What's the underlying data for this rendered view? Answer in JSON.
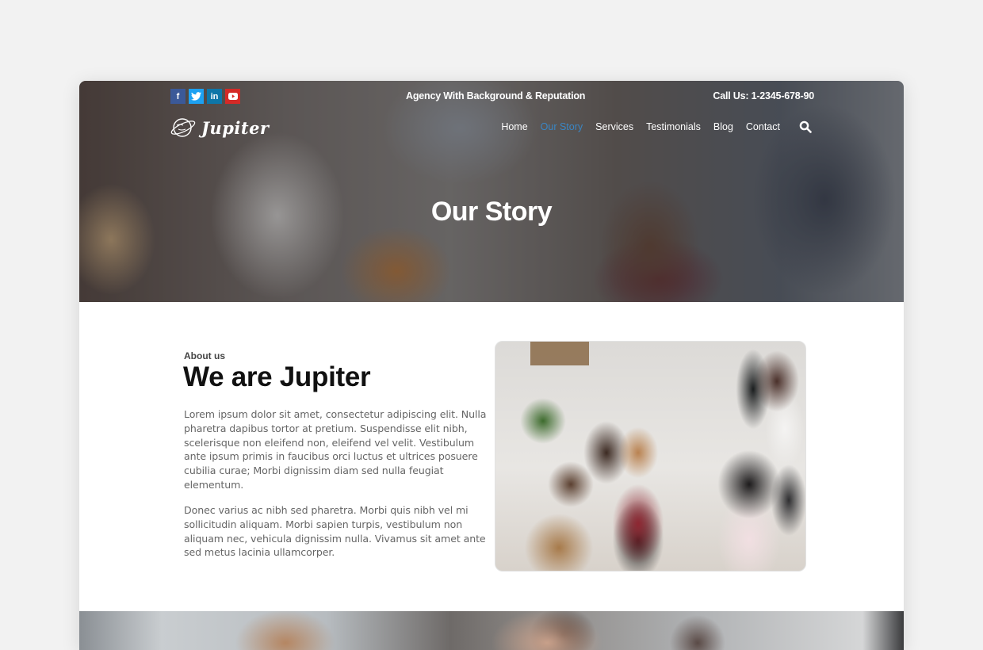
{
  "header": {
    "social": [
      {
        "name": "facebook",
        "glyph": "f",
        "color": "#3b5998"
      },
      {
        "name": "twitter",
        "glyph": "t",
        "color": "#1da1f2"
      },
      {
        "name": "linkedin",
        "glyph": "in",
        "color": "#0e76a8"
      },
      {
        "name": "youtube",
        "glyph": "▶",
        "color": "#d52a27"
      }
    ],
    "tagline": "Agency With Background & Reputation",
    "phone": "Call Us: 1-2345-678-90",
    "logo_text": "Jupiter",
    "nav": [
      {
        "label": "Home",
        "active": false
      },
      {
        "label": "Our Story",
        "active": true
      },
      {
        "label": "Services",
        "active": false
      },
      {
        "label": "Testimonials",
        "active": false
      },
      {
        "label": "Blog",
        "active": false
      },
      {
        "label": "Contact",
        "active": false
      }
    ],
    "search_icon": "search-icon",
    "active_color": "#3a86c4"
  },
  "hero": {
    "title": "Our Story"
  },
  "about": {
    "label": "About us",
    "title": "We are Jupiter",
    "paragraphs": [
      "Lorem ipsum dolor sit amet, consectetur adipiscing elit. Nulla pharetra dapibus tortor at pretium. Suspendisse elit nibh, scelerisque non eleifend non, eleifend vel velit. Vestibulum ante ipsum primis in faucibus orci luctus et ultrices posuere cubilia curae; Morbi dignissim diam sed nulla feugiat elementum.",
      "Donec varius ac nibh sed pharetra. Morbi quis nibh vel mi sollicitudin aliquam. Morbi sapien turpis, vestibulum non aliquam nec, vehicula dignissim nulla. Vivamus sit amet ante sed metus lacinia ullamcorper."
    ],
    "photo_alt": "Speaker presenting to seated audience"
  }
}
